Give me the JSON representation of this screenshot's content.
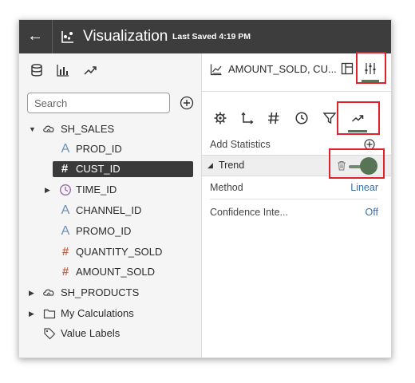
{
  "header": {
    "back_icon": "arrow-left-icon",
    "viz_icon": "visualization-icon",
    "title": "Visualization",
    "saved": "Last Saved 4:19 PM"
  },
  "left_tabs": [
    {
      "name": "data-icon",
      "active": true
    },
    {
      "name": "bar-chart-icon",
      "active": false
    },
    {
      "name": "trend-icon",
      "active": false
    }
  ],
  "search": {
    "placeholder": "Search"
  },
  "tree": [
    {
      "label": "SH_SALES",
      "icon": "database-icon",
      "expanded": true
    },
    {
      "label": "PROD_ID",
      "type": "A"
    },
    {
      "label": "CUST_ID",
      "type": "#",
      "selected": true
    },
    {
      "label": "TIME_ID",
      "type": "clock"
    },
    {
      "label": "CHANNEL_ID",
      "type": "A"
    },
    {
      "label": "PROMO_ID",
      "type": "A"
    },
    {
      "label": "QUANTITY_SOLD",
      "type": "#"
    },
    {
      "label": "AMOUNT_SOLD",
      "type": "#"
    },
    {
      "label": "SH_PRODUCTS",
      "icon": "database-icon"
    },
    {
      "label": "My Calculations",
      "icon": "folder-icon"
    },
    {
      "label": "Value Labels",
      "icon": "tag-icon"
    }
  ],
  "right": {
    "field_name": "AMOUNT_SOLD, CU...",
    "prop_tabs": [
      "gear-icon",
      "axis-icon",
      "hash-icon",
      "clock-icon",
      "filter-icon",
      "trend-icon"
    ],
    "add_statistics": "Add Statistics",
    "trend_section": "Trend",
    "method_label": "Method",
    "method_value": "Linear",
    "confidence_label": "Confidence Inte...",
    "confidence_value": "Off"
  },
  "colors": {
    "header_bg": "#3d3d3d",
    "accent": "#577556",
    "highlight": "#e0202a",
    "link": "#3a6ea5"
  }
}
